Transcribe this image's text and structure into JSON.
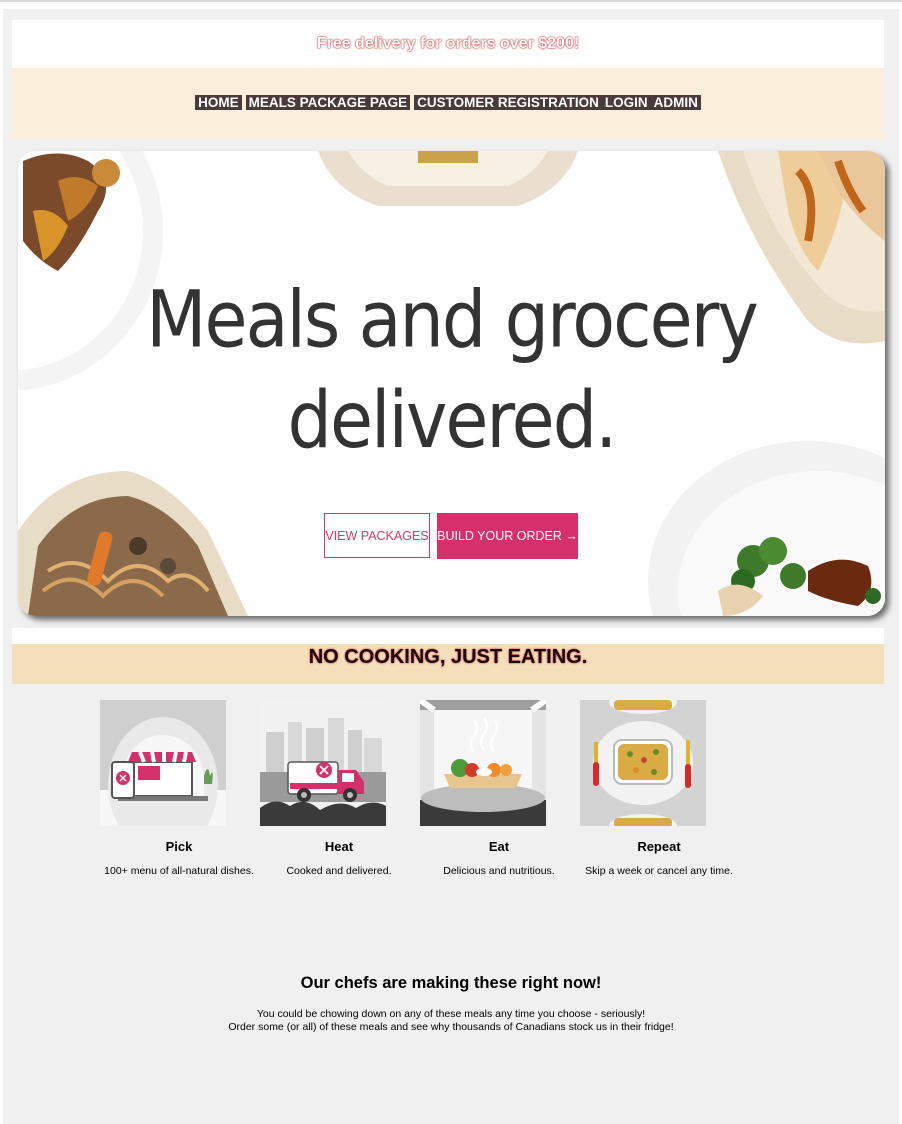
{
  "promo": {
    "text": "Free delivery for orders over $200!"
  },
  "nav": {
    "items": [
      "HOME",
      "MEALS PACKAGE PAGE",
      "CUSTOMER REGISTRATION",
      "LOGIN",
      "ADMIN"
    ]
  },
  "hero": {
    "title_line1": "Meals and grocery",
    "title_line2": "delivered.",
    "view_packages": "VIEW PACKAGES",
    "build_order": "BUILD YOUR ORDER →"
  },
  "slogan": {
    "text": "NO COOKING, JUST EATING."
  },
  "steps": [
    {
      "title": "Pick",
      "desc": "100+ menu of all-natural dishes."
    },
    {
      "title": "Heat",
      "desc": "Cooked and delivered."
    },
    {
      "title": "Eat",
      "desc": "Delicious and nutritious."
    },
    {
      "title": "Repeat",
      "desc": "Skip a week or cancel any time."
    }
  ],
  "chefs": {
    "title": "Our chefs are making these right now!",
    "line1": "You could be chowing down on any of these meals any time you choose - seriously!",
    "line2": "Order some (or all) of these meals and see why thousands of Canadians stock us in their fridge!"
  },
  "colors": {
    "nav_bg": "#fbeedb",
    "nav_link_bg": "#4a3a3c",
    "slogan_bg": "#f3dfb9",
    "accent": "#d6306a",
    "page_bg": "#f0f0f0"
  }
}
